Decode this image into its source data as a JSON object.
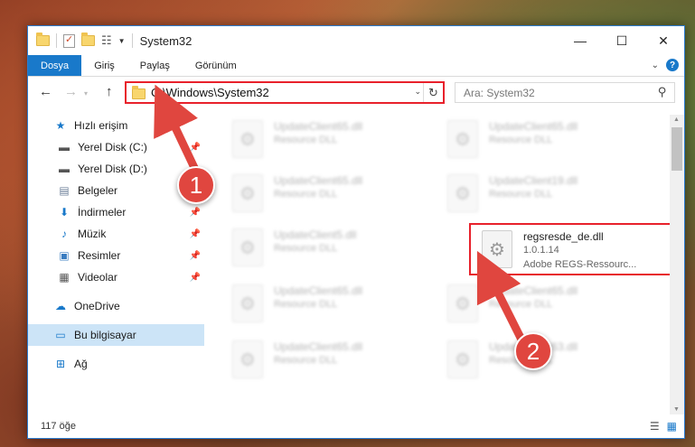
{
  "window": {
    "title": "System32",
    "minimize": "—",
    "maximize": "☐",
    "close": "✕"
  },
  "ribbon": {
    "tabs": [
      "Dosya",
      "Giriş",
      "Paylaş",
      "Görünüm"
    ],
    "help": "?"
  },
  "navigation": {
    "back": "←",
    "forward": "→",
    "up": "↑",
    "address": "C:\\Windows\\System32",
    "refresh": "↻",
    "search_placeholder": "Ara: System32"
  },
  "sidebar": {
    "items": [
      {
        "label": "Hızlı erişim",
        "icon": "star-icon"
      },
      {
        "label": "Yerel Disk (C:)",
        "icon": "drive-icon",
        "pinned": true
      },
      {
        "label": "Yerel Disk (D:)",
        "icon": "drive-icon"
      },
      {
        "label": "Belgeler",
        "icon": "document-icon",
        "pinned": true
      },
      {
        "label": "İndirmeler",
        "icon": "download-icon",
        "pinned": true
      },
      {
        "label": "Müzik",
        "icon": "music-icon",
        "pinned": true
      },
      {
        "label": "Resimler",
        "icon": "pictures-icon",
        "pinned": true
      },
      {
        "label": "Videolar",
        "icon": "video-icon",
        "pinned": true
      },
      {
        "label": "OneDrive",
        "icon": "cloud-icon"
      },
      {
        "label": "Bu bilgisayar",
        "icon": "computer-icon",
        "selected": true
      },
      {
        "label": "Ağ",
        "icon": "network-icon"
      }
    ]
  },
  "files": [
    {
      "name": "UpdateClient65.dll",
      "type": "Resource DLL",
      "blurred": true
    },
    {
      "name": "UpdateClient65.dll",
      "type": "Resource DLL",
      "blurred": true
    },
    {
      "name": "UpdateClient65.dll",
      "type": "Resource DLL",
      "blurred": true
    },
    {
      "name": "UpdateClient19.dll",
      "type": "Resource DLL",
      "blurred": true
    },
    {
      "name": "UpdateClient5.dll",
      "type": "Resource DLL",
      "blurred": true
    },
    {
      "name": "regsresde_de.dll",
      "version": "1.0.1.14",
      "type": "Adobe REGS-Ressourc...",
      "highlighted": true
    },
    {
      "name": "UpdateClient65.dll",
      "type": "Resource DLL",
      "blurred": true
    },
    {
      "name": "UpdateClient65.dll",
      "type": "Resource DLL",
      "blurred": true
    },
    {
      "name": "UpdateClient65.dll",
      "type": "Resource DLL",
      "blurred": true
    },
    {
      "name": "UpdateClient63.dll",
      "type": "Resource DLL",
      "blurred": true
    }
  ],
  "status": {
    "item_count": "117 öğe"
  },
  "callouts": [
    "1",
    "2"
  ],
  "colors": {
    "accent": "#1979ca",
    "highlight": "#e8212b",
    "callout": "#e0463f"
  }
}
